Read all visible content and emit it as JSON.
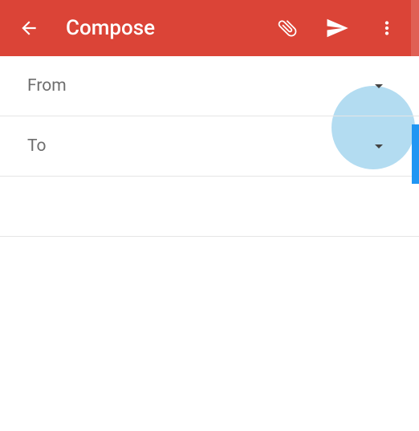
{
  "toolbar": {
    "title": "Compose"
  },
  "fields": {
    "from_label": "From",
    "to_label": "To"
  },
  "colors": {
    "primary": "#db4437",
    "highlight": "#b3dcf1",
    "scroll": "#2196f3"
  }
}
